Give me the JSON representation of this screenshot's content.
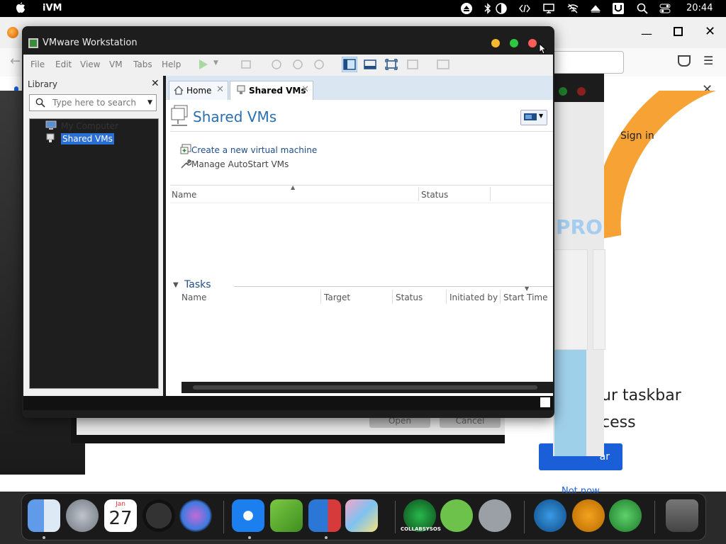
{
  "menubar": {
    "app_name": "iVM",
    "clock": "20:44",
    "status_icons": [
      "eject-icon",
      "bluetooth-icon",
      "contrast-icon",
      "code-icon",
      "display-icon",
      "wifi-off-icon",
      "upload-icon",
      "u-icon",
      "search-icon",
      "control-center-icon"
    ]
  },
  "background_browser": {
    "sign_in": "Sign in",
    "promo_line1": "ur taskbar",
    "promo_line2": "cess",
    "button_label": "ar",
    "not_now": "Not now"
  },
  "background_window": {
    "pro_text": "PRO",
    "card_text_1": "a",
    "card_text_2": "er"
  },
  "dialog_behind": {
    "open_label": "Open",
    "cancel_label": "Cancel"
  },
  "vmware": {
    "title": "VMware Workstation",
    "menu": [
      "File",
      "Edit",
      "View",
      "VM",
      "Tabs",
      "Help"
    ],
    "library": {
      "label": "Library",
      "search_placeholder": "Type here to search",
      "tree": [
        "My Computer",
        "Shared VMs"
      ]
    },
    "tabs": [
      {
        "label": "Home"
      },
      {
        "label": "Shared VMs"
      }
    ],
    "page_title": "Shared VMs",
    "actions": [
      "Create a new virtual machine",
      "Manage AutoStart VMs"
    ],
    "vm_columns": [
      "Name",
      "Status"
    ],
    "tasks_label": "Tasks",
    "task_columns": [
      "Name",
      "Target",
      "Status",
      "Initiated by",
      "Start Time"
    ]
  },
  "dock": {
    "calendar_month": "Jan",
    "calendar_day": "27",
    "collabsysos_label": "COLLABSYSOS"
  }
}
